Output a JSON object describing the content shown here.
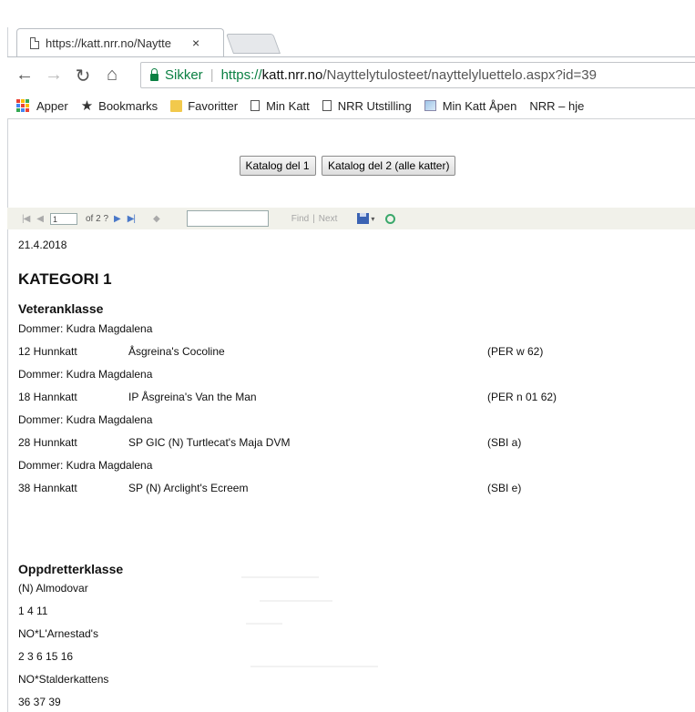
{
  "browser": {
    "tab_title": "https://katt.nrr.no/Naytte",
    "tab_close": "×",
    "secure_label": "Sikker",
    "url_protocol": "https://",
    "url_host": "katt.nrr.no",
    "url_path": "/Nayttelytulosteet/nayttelyluettelo.aspx?id=39",
    "bookmarks": [
      "Apper",
      "Bookmarks",
      "Favoritter",
      "Min Katt",
      "NRR Utstilling",
      "Min Katt Åpen",
      "NRR – hje"
    ]
  },
  "buttons": {
    "katalog1": "Katalog del 1",
    "katalog2": "Katalog del 2 (alle katter)"
  },
  "toolbar": {
    "page": "1",
    "of_text": "of 2 ?",
    "find": "Find",
    "sep": "|",
    "next": "Next"
  },
  "report": {
    "date": "21.4.2018",
    "category": "KATEGORI 1",
    "class1": "Veteranklasse",
    "entries": [
      {
        "judge": "Dommer: Kudra Magdalena",
        "num": "12 Hunnkatt",
        "name": "Åsgreina's Cocoline",
        "code": "(PER w 62)"
      },
      {
        "judge": "Dommer: Kudra Magdalena",
        "num": "18 Hannkatt",
        "name": "IP Åsgreina's Van the Man",
        "code": "(PER n 01 62)"
      },
      {
        "judge": "Dommer: Kudra Magdalena",
        "num": "28 Hunnkatt",
        "name": "SP GIC (N) Turtlecat's Maja DVM",
        "code": "(SBI a)"
      },
      {
        "judge": "Dommer: Kudra Magdalena",
        "num": "38 Hannkatt",
        "name": "SP (N) Arclight's Ecreem",
        "code": "(SBI e)"
      }
    ],
    "class2": "Oppdretterklasse",
    "breeders": [
      {
        "name": "(N) Almodovar",
        "numbers": "1 4 11"
      },
      {
        "name": "NO*L'Arnestad's",
        "numbers": "2 3 6 15 16"
      },
      {
        "name": "NO*Stalderkattens",
        "numbers": "36 37 39"
      }
    ]
  }
}
